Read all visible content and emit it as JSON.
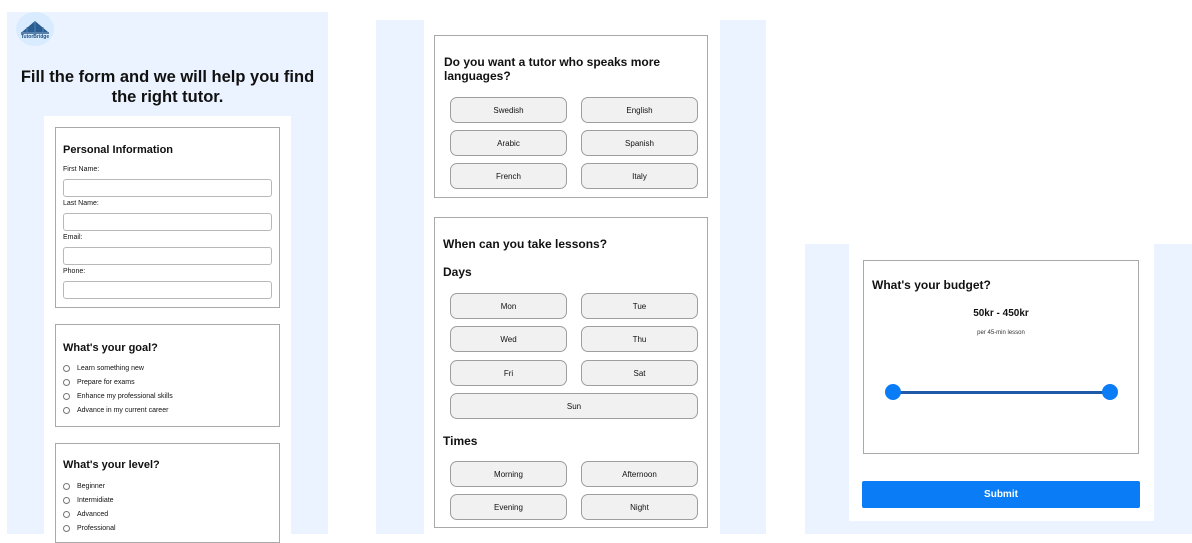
{
  "brand": {
    "logo_text": "TutorBridge"
  },
  "form": {
    "heading": "Fill the form and we will help you find the right tutor.",
    "personal": {
      "title": "Personal Information",
      "first_name_label": "First Name:",
      "last_name_label": "Last Name:",
      "email_label": "Email:",
      "phone_label": "Phone:"
    },
    "goal": {
      "title": "What's your goal?",
      "options": [
        "Learn something new",
        "Prepare for exams",
        "Enhance my professional skills",
        "Advance in my current career"
      ]
    },
    "level": {
      "title": "What's your level?",
      "options": [
        "Beginner",
        "Intermidiate",
        "Advanced",
        "Professional"
      ]
    },
    "languages": {
      "title": "Do you want a tutor who speaks more languages?",
      "options": [
        "Swedish",
        "English",
        "Arabic",
        "Spanish",
        "French",
        "Italy"
      ]
    },
    "schedule": {
      "title": "When can you take lessons?",
      "days_label": "Days",
      "days": [
        "Mon",
        "Tue",
        "Wed",
        "Thu",
        "Fri",
        "Sat",
        "Sun"
      ],
      "times_label": "Times",
      "times": [
        "Morning",
        "Afternoon",
        "Evening",
        "Night"
      ]
    },
    "budget": {
      "title": "What's your budget?",
      "range_text": "50kr - 450kr",
      "note": "per 45-min lesson",
      "min_fraction": 0,
      "max_fraction": 1
    },
    "submit_label": "Submit"
  },
  "colors": {
    "accent": "#0a7cf5",
    "panel_bg": "#eaf3ff",
    "border": "#a9a9a9",
    "button_bg": "#f1f1f1"
  }
}
